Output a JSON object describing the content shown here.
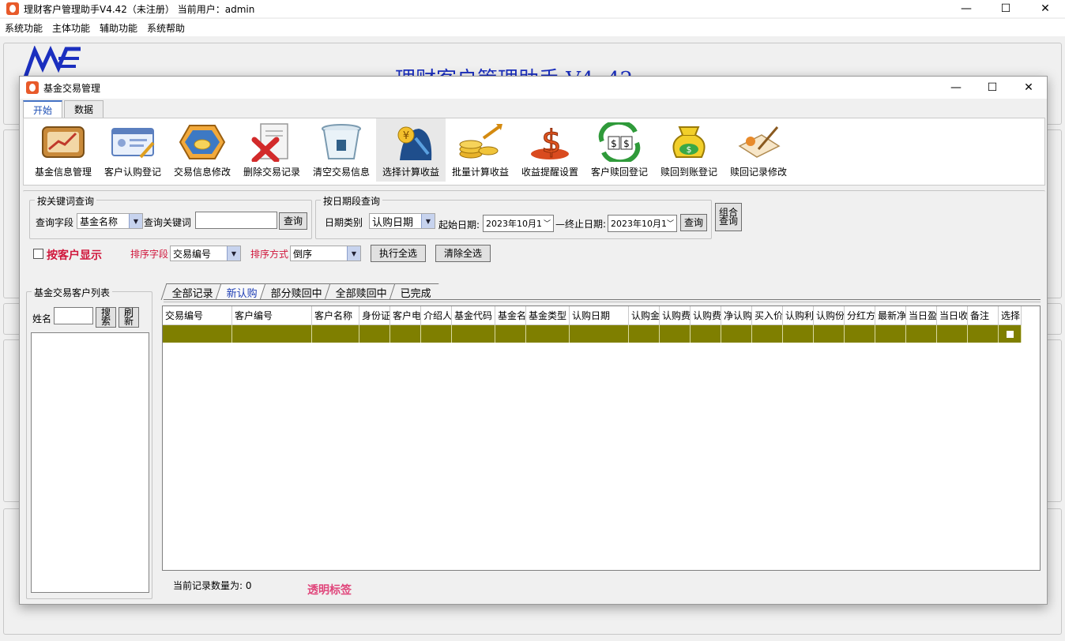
{
  "main_window": {
    "title": "理财客户管理助手V4.42（未注册） 当前用户：admin",
    "minimize": "—",
    "maximize": "☐",
    "close": "✕",
    "menu": [
      "系统功能",
      "主体功能",
      "辅助功能",
      "系统帮助"
    ],
    "background_title": "理财客户管理助手  V4. 42"
  },
  "dialog": {
    "title": "基金交易管理",
    "minimize": "—",
    "maximize": "☐",
    "close": "✕"
  },
  "ribbon": {
    "tabs": [
      "开始",
      "数据"
    ],
    "active_tab": "开始",
    "tools": [
      {
        "label": "基金信息管理",
        "icon": "book-chart-icon"
      },
      {
        "label": "客户认购登记",
        "icon": "id-card-icon"
      },
      {
        "label": "交易信息修改",
        "icon": "coins-hexagon-icon"
      },
      {
        "label": "删除交易记录",
        "icon": "delete-document-icon"
      },
      {
        "label": "清空交易信息",
        "icon": "trash-bin-icon"
      },
      {
        "label": "选择计算收益",
        "icon": "yen-person-icon"
      },
      {
        "label": "批量计算收益",
        "icon": "coin-stack-icon"
      },
      {
        "label": "收益提醒设置",
        "icon": "dollar-sign-icon"
      },
      {
        "label": "客户赎回登记",
        "icon": "dollar-exchange-icon"
      },
      {
        "label": "赎回到账登记",
        "icon": "money-bag-icon"
      },
      {
        "label": "赎回记录修改",
        "icon": "edit-notepad-icon"
      }
    ]
  },
  "keyword_query": {
    "legend": "按关键词查询",
    "field_label": "查询字段",
    "field_value": "基金名称",
    "keyword_label": "查询关键词",
    "keyword_value": "",
    "query_button": "查询"
  },
  "date_query": {
    "legend": "按日期段查询",
    "type_label": "日期类别",
    "type_value": "认购日期",
    "start_label": "起始日期:",
    "start_value": "2023年10月1",
    "end_label": "—终止日期:",
    "end_value": "2023年10月1",
    "query_button": "查询",
    "combo_button": "组合查询"
  },
  "options": {
    "by_customer_label": "按客户显示",
    "sort_field_label": "排序字段",
    "sort_field_value": "交易编号",
    "sort_order_label": "排序方式",
    "sort_order_value": "倒序",
    "select_all_button": "执行全选",
    "clear_all_button": "清除全选"
  },
  "customer_list": {
    "legend": "基金交易客户列表",
    "name_label": "姓名",
    "name_value": "",
    "search_button": "搜索",
    "refresh_button": "刷新"
  },
  "result_tabs": [
    "全部记录",
    "新认购",
    "部分赎回中",
    "全部赎回中",
    "已完成"
  ],
  "active_result_tab": "新认购",
  "grid": {
    "columns": [
      "交易编号",
      "客户编号",
      "客户名称",
      "身份证",
      "客户电",
      "介绍人",
      "基金代码",
      "基金名",
      "基金类型",
      "认购日期",
      "认购金",
      "认购费",
      "认购费",
      "净认购",
      "买入价",
      "认购利",
      "认购份",
      "分红方",
      "最新净",
      "当日盈",
      "当日收",
      "备注",
      "选择"
    ],
    "rows": [
      [
        "",
        "",
        "",
        "",
        "",
        "",
        "",
        "",
        "",
        "",
        "",
        "",
        "",
        "",
        "",
        "",
        "",
        "",
        "",
        "",
        "",
        "",
        ""
      ]
    ],
    "row_color": "#7f7f00"
  },
  "status": {
    "count_label": "当前记录数量为:  0",
    "transparent_label": "透明标签"
  }
}
